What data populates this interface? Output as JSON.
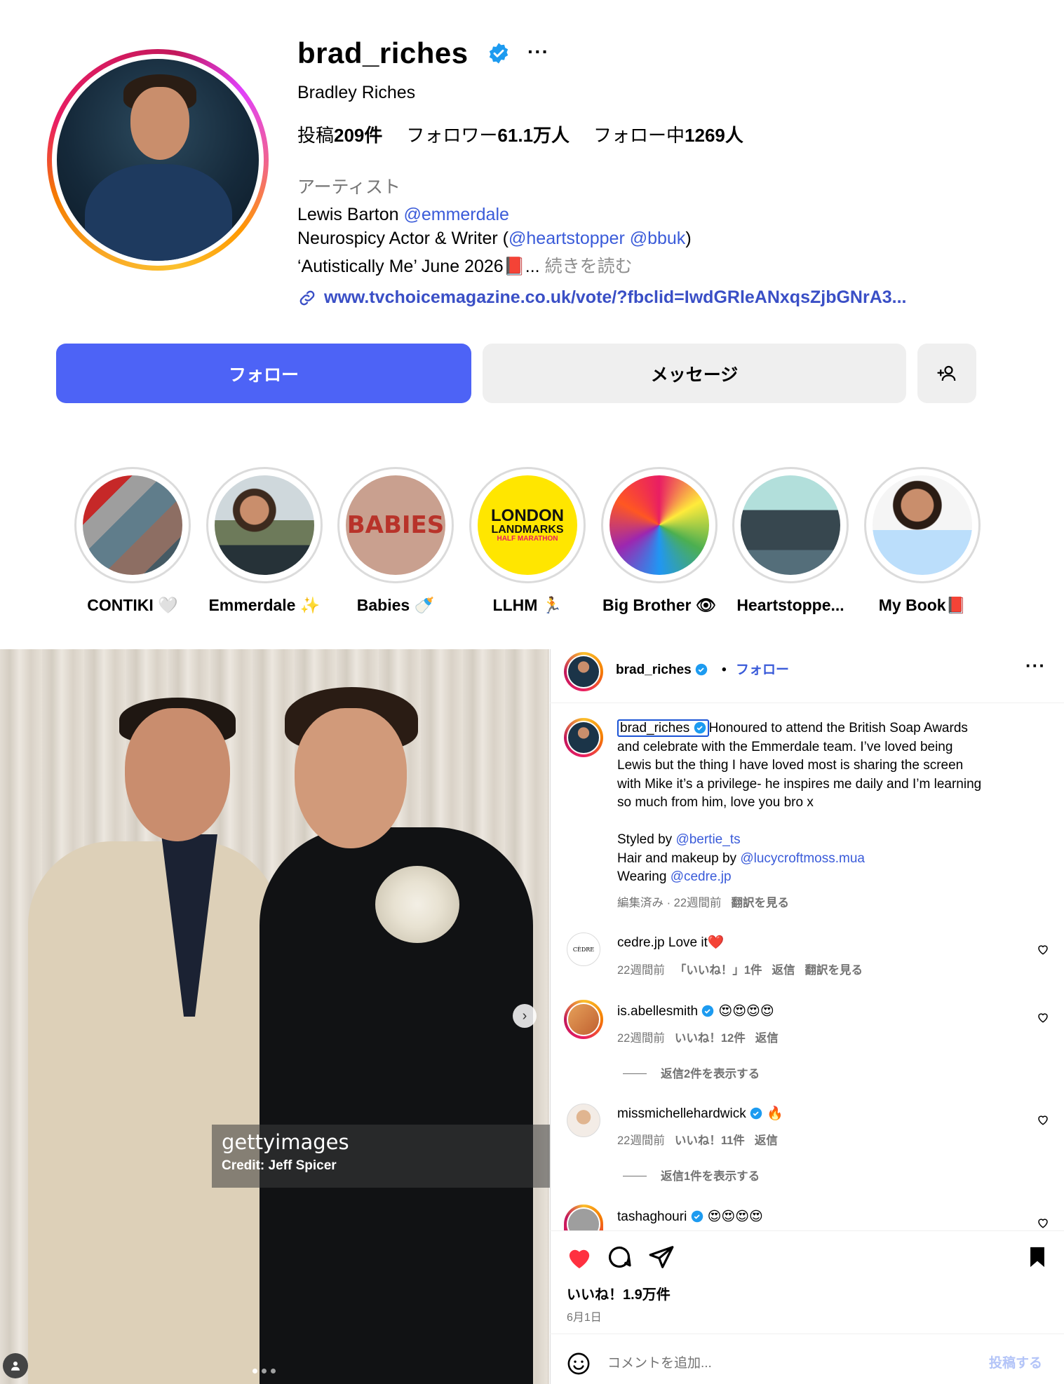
{
  "profile": {
    "username": "brad_riches",
    "more": "···",
    "full_name": "Bradley Riches",
    "stats": {
      "posts_label": "投稿",
      "posts_value": "209件",
      "followers_label": "フォロワー",
      "followers_value": "61.1万人",
      "following_label": "フォロー中",
      "following_value": "1269人"
    },
    "category": "アーティスト",
    "bio": {
      "line1_text": "Lewis Barton ",
      "line1_link": "@emmerdale",
      "line2_text": "Neurospicy Actor & Writer (",
      "line2_link1": "@heartstopper",
      "line2_link2": "@bbuk",
      "line2_end": ")",
      "line3_text": "‘Autistically Me’ June 2026📕...",
      "line3_more": " 続きを読む"
    },
    "link": "www.tvchoicemagazine.co.uk/vote/?fbclid=IwdGRleANxqsZjbGNrA3..."
  },
  "buttons": {
    "follow": "フォロー",
    "message": "メッセージ"
  },
  "highlights": [
    {
      "label": "CONTIKI 🤍"
    },
    {
      "label": "Emmerdale ✨"
    },
    {
      "label": "Babies 🍼"
    },
    {
      "label": "LLHM 🏃"
    },
    {
      "label": "Big Brother 👁"
    },
    {
      "label": "Heartstoppe..."
    },
    {
      "label": "My Book📕"
    }
  ],
  "highlight_art": {
    "babies_text": "BABIES",
    "london_line1": "LONDON",
    "london_line2": "LANDMARKS",
    "london_line3": "HALF MARATHON"
  },
  "photo": {
    "watermark": "gettyimages",
    "credit": "Credit: Jeff Spicer"
  },
  "post": {
    "author": "brad_riches",
    "dot": "•",
    "follow": "フォロー",
    "caption_author": "brad_riches",
    "caption_lines": [
      "Honoured to attend the British Soap Awards",
      "and celebrate with the Emmerdale team. I’ve loved being",
      "Lewis but the thing I have loved most is sharing the screen",
      "with Mike it’s a privilege- he inspires me daily and I’m learning",
      "so much from him, love you bro x"
    ],
    "styled_by": "Styled by ",
    "styled_by_link": "@bertie_ts",
    "hair_by": "Hair and makeup by ",
    "hair_by_link": "@lucycroftmoss.mua",
    "wearing": "Wearing ",
    "wearing_link": "@cedre.jp",
    "caption_meta": "編集済み · 22週間前",
    "caption_translate": "翻訳を見る",
    "likes": "いいね！1.9万件",
    "date": "6月1日",
    "comment_placeholder": "コメントを追加...",
    "post_button": "投稿する"
  },
  "comments": [
    {
      "user": "cedre.jp",
      "text": " Love it❤️",
      "time": "22週間前",
      "likes": "「いいね！」1件",
      "reply": "返信",
      "translate": "翻訳を見る",
      "avatar_text": "CÈDRE"
    },
    {
      "user": "is.abellesmith",
      "text": " 😍😍😍😍",
      "time": "22週間前",
      "likes": "いいね！12件",
      "reply": "返信",
      "view_replies": "返信2件を表示する"
    },
    {
      "user": "missmichellehardwick",
      "text": " 🔥",
      "time": "22週間前",
      "likes": "いいね！11件",
      "reply": "返信",
      "view_replies": "返信1件を表示する"
    },
    {
      "user": "tashaghouri",
      "text": " 😍😍😍😍"
    }
  ],
  "colors": {
    "accent": "#4d63f6",
    "link": "#3a5bd9",
    "verified": "#1d9bf0",
    "liked": "#ff3040"
  },
  "icons": [
    "verified-badge-icon",
    "more-icon",
    "link-icon",
    "add-user-icon",
    "heart-icon",
    "comment-icon",
    "share-icon",
    "bookmark-icon",
    "emoji-icon",
    "next-arrow-icon"
  ]
}
